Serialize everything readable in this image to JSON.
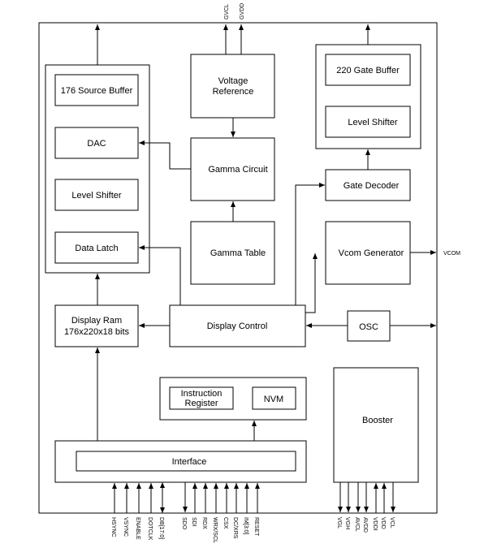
{
  "blocks": {
    "source_buffer": "176 Source Buffer",
    "dac": "DAC",
    "level_shifter_source": "Level Shifter",
    "data_latch": "Data Latch",
    "voltage_reference": [
      "Voltage",
      "Reference"
    ],
    "gamma_circuit": "Gamma Circuit",
    "gamma_table": "Gamma Table",
    "gate_buffer": "220 Gate Buffer",
    "level_shifter_gate": "Level Shifter",
    "gate_decoder": "Gate Decoder",
    "vcom_generator": "Vcom Generator",
    "display_ram": [
      "Display Ram",
      "176x220x18 bits"
    ],
    "display_control": "Display Control",
    "osc": "OSC",
    "instruction_register": [
      "Instruction",
      "Register"
    ],
    "nvm": "NVM",
    "booster": "Booster",
    "interface": "Interface"
  },
  "top_pins": [
    "GVCL",
    "GVDD"
  ],
  "right_pin": "VCOM",
  "interface_pins": [
    "HSYNC",
    "VSYNC",
    "ENABLE",
    "DOTCLK",
    "DB[17:0]",
    "SDO",
    "SDI",
    "RDX",
    "WRX/SCL",
    "CSX",
    "DC/XRS",
    "IM[3:0]",
    "RESET"
  ],
  "booster_pins": [
    "VGL",
    "VGH",
    "AVCL",
    "AVDD",
    "VDDI",
    "VDD",
    "VCL"
  ]
}
